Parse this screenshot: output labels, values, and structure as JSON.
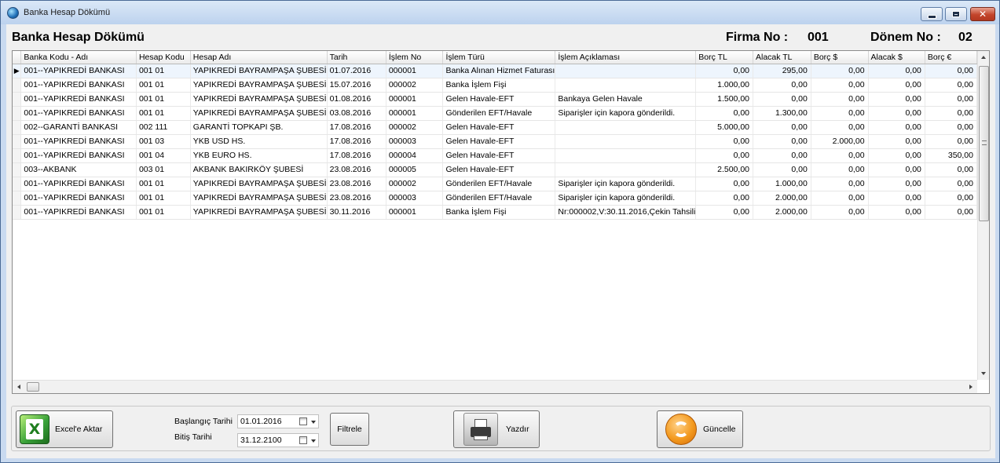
{
  "window": {
    "title": "Banka Hesap Dökümü"
  },
  "header": {
    "title": "Banka Hesap Dökümü",
    "firma_label": "Firma No :",
    "firma_value": "001",
    "donem_label": "Dönem No :",
    "donem_value": "02"
  },
  "grid": {
    "columns": [
      "Banka Kodu - Adı",
      "Hesap Kodu",
      "Hesap Adı",
      "Tarih",
      "İşlem No",
      "İşlem Türü",
      "İşlem Açıklaması",
      "Borç TL",
      "Alacak TL",
      "Borç $",
      "Alacak $",
      "Borç €"
    ],
    "rows": [
      [
        "001--YAPIKREDİ BANKASI",
        "001  01",
        "YAPIKREDİ BAYRAMPAŞA ŞUBESİ",
        "01.07.2016",
        "000001",
        "Banka Alınan Hizmet Faturası",
        "",
        "0,00",
        "295,00",
        "0,00",
        "0,00",
        "0,00"
      ],
      [
        "001--YAPIKREDİ BANKASI",
        "001  01",
        "YAPIKREDİ BAYRAMPAŞA ŞUBESİ",
        "15.07.2016",
        "000002",
        "Banka İşlem Fişi",
        "",
        "1.000,00",
        "0,00",
        "0,00",
        "0,00",
        "0,00"
      ],
      [
        "001--YAPIKREDİ BANKASI",
        "001  01",
        "YAPIKREDİ BAYRAMPAŞA ŞUBESİ",
        "01.08.2016",
        "000001",
        "Gelen Havale-EFT",
        "Bankaya Gelen Havale",
        "1.500,00",
        "0,00",
        "0,00",
        "0,00",
        "0,00"
      ],
      [
        "001--YAPIKREDİ BANKASI",
        "001  01",
        "YAPIKREDİ BAYRAMPAŞA ŞUBESİ",
        "03.08.2016",
        "000001",
        "Gönderilen EFT/Havale",
        "Siparişler için kapora gönderildi.",
        "0,00",
        "1.300,00",
        "0,00",
        "0,00",
        "0,00"
      ],
      [
        "002--GARANTİ BANKASI",
        "002  111",
        "GARANTİ TOPKAPI ŞB.",
        "17.08.2016",
        "000002",
        "Gelen Havale-EFT",
        "",
        "5.000,00",
        "0,00",
        "0,00",
        "0,00",
        "0,00"
      ],
      [
        "001--YAPIKREDİ BANKASI",
        "001  03",
        "YKB USD HS.",
        "17.08.2016",
        "000003",
        "Gelen Havale-EFT",
        "",
        "0,00",
        "0,00",
        "2.000,00",
        "0,00",
        "0,00"
      ],
      [
        "001--YAPIKREDİ BANKASI",
        "001  04",
        "YKB EURO HS.",
        "17.08.2016",
        "000004",
        "Gelen Havale-EFT",
        "",
        "0,00",
        "0,00",
        "0,00",
        "0,00",
        "350,00"
      ],
      [
        "003--AKBANK",
        "003  01",
        "AKBANK BAKIRKÖY ŞUBESİ",
        "23.08.2016",
        "000005",
        "Gelen Havale-EFT",
        "",
        "2.500,00",
        "0,00",
        "0,00",
        "0,00",
        "0,00"
      ],
      [
        "001--YAPIKREDİ BANKASI",
        "001  01",
        "YAPIKREDİ BAYRAMPAŞA ŞUBESİ",
        "23.08.2016",
        "000002",
        "Gönderilen EFT/Havale",
        "Siparişler için kapora gönderildi.",
        "0,00",
        "1.000,00",
        "0,00",
        "0,00",
        "0,00"
      ],
      [
        "001--YAPIKREDİ BANKASI",
        "001  01",
        "YAPIKREDİ BAYRAMPAŞA ŞUBESİ",
        "23.08.2016",
        "000003",
        "Gönderilen EFT/Havale",
        "Siparişler için kapora gönderildi.",
        "0,00",
        "2.000,00",
        "0,00",
        "0,00",
        "0,00"
      ],
      [
        "001--YAPIKREDİ BANKASI",
        "001  01",
        "YAPIKREDİ BAYRAMPAŞA ŞUBESİ",
        "30.11.2016",
        "000001",
        "Banka İşlem Fişi",
        "Nr:000002,V:30.11.2016,Çekin Tahsili",
        "0,00",
        "2.000,00",
        "0,00",
        "0,00",
        "0,00"
      ]
    ]
  },
  "toolbar": {
    "excel_label": "Excel'e Aktar",
    "start_label": "Başlangıç Tarihi",
    "start_value": "01.01.2016",
    "end_label": "Bitiş Tarihi",
    "end_value": "31.12.2100",
    "filter_label": "Filtrele",
    "print_label": "Yazdır",
    "update_label": "Güncelle"
  },
  "icons": [
    "globe-icon",
    "minimize-icon",
    "maximize-icon",
    "close-icon",
    "excel-icon",
    "calendar-icon",
    "printer-icon",
    "refresh-icon"
  ]
}
